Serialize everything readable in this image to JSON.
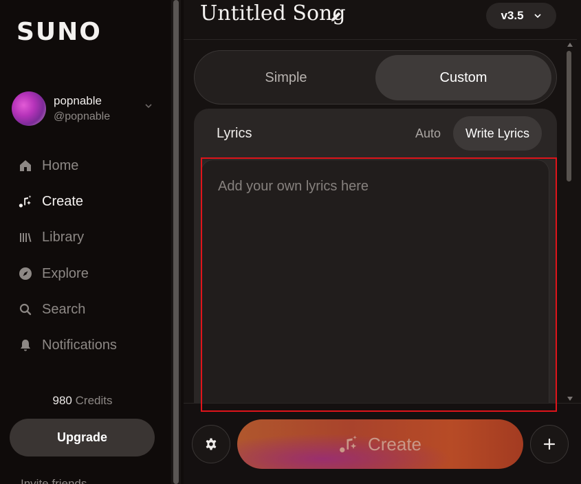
{
  "sidebar": {
    "logo": "SUNO",
    "profile": {
      "name": "popnable",
      "handle": "@popnable"
    },
    "nav": [
      {
        "label": "Home",
        "icon": "home-icon"
      },
      {
        "label": "Create",
        "icon": "create-icon",
        "active": true
      },
      {
        "label": "Library",
        "icon": "library-icon"
      },
      {
        "label": "Explore",
        "icon": "compass-icon"
      },
      {
        "label": "Search",
        "icon": "search-icon"
      },
      {
        "label": "Notifications",
        "icon": "bell-icon"
      }
    ],
    "credits": {
      "value": "980",
      "label": "Credits"
    },
    "upgrade_label": "Upgrade",
    "bottom_partial": "Invite friends"
  },
  "header": {
    "song_title": "Untitled Song",
    "version": "v3.5"
  },
  "mode": {
    "simple": "Simple",
    "custom": "Custom",
    "selected": "Custom"
  },
  "lyrics": {
    "label": "Lyrics",
    "auto_label": "Auto",
    "write_label": "Write Lyrics",
    "placeholder": "Add your own lyrics here"
  },
  "footer": {
    "create_label": "Create"
  },
  "colors": {
    "background": "#100c0b",
    "accent": "#b0572d",
    "highlight": "#e0141a"
  }
}
